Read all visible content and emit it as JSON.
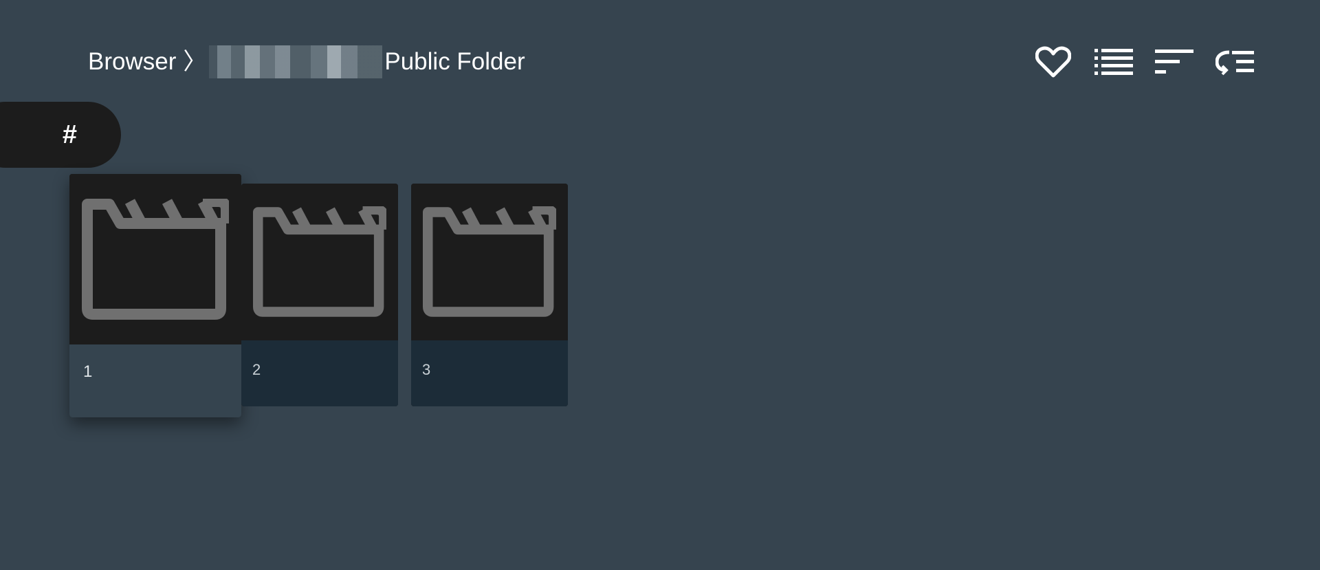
{
  "breadcrumb": {
    "root": "Browser",
    "separator": "〉",
    "current": "Public Folder"
  },
  "toolbar": {
    "icons": [
      "heart-icon",
      "list-view-icon",
      "sort-icon",
      "shuffle-list-icon"
    ]
  },
  "alpha_jump": {
    "label": "#"
  },
  "items": [
    {
      "label": "1",
      "icon": "clapperboard-icon",
      "focused": true
    },
    {
      "label": "2",
      "icon": "clapperboard-icon",
      "focused": false
    },
    {
      "label": "3",
      "icon": "clapperboard-icon",
      "focused": false
    }
  ],
  "colors": {
    "background": "#36444f",
    "card": "#1c1c1c",
    "caption": "#1c2c38",
    "icon": "#707070",
    "text": "#ffffff"
  }
}
